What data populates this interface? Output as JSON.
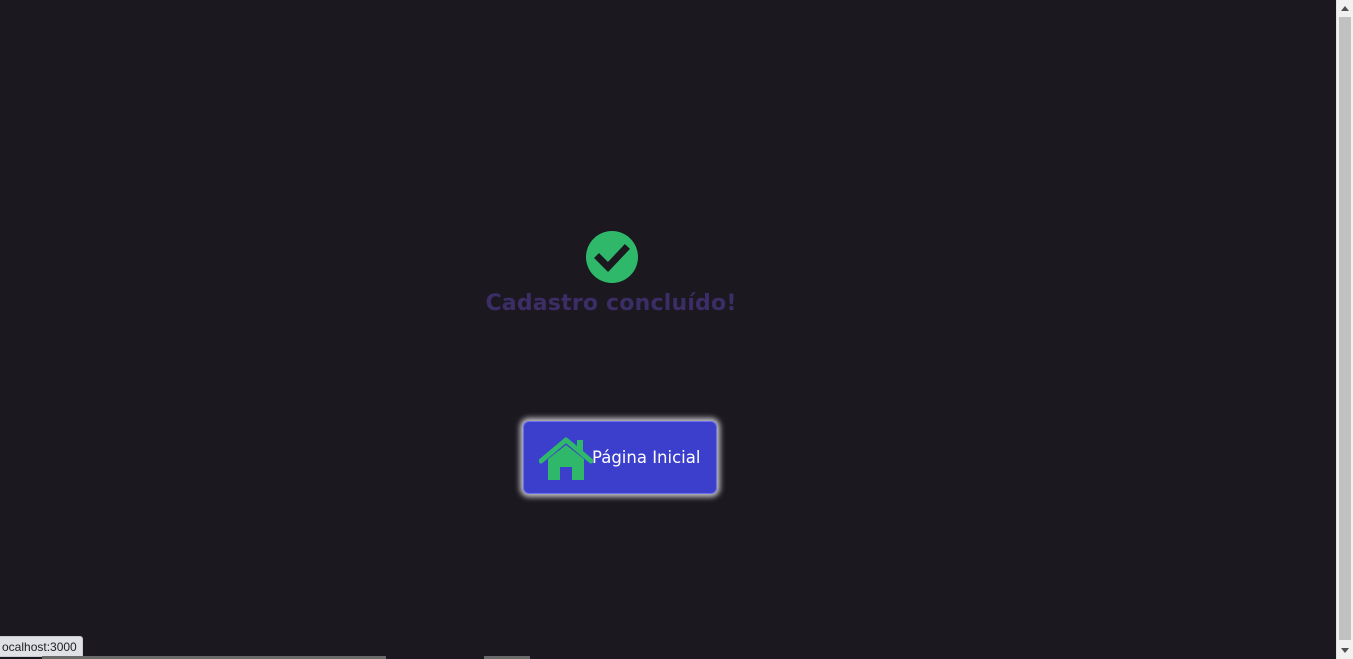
{
  "page": {
    "title": "Cadastro concluído!",
    "status_icon": "check-circle-icon",
    "status_color": "#2fb86a",
    "title_color": "#3b2e66",
    "background_color": "#1b1820"
  },
  "home_button": {
    "label": "Página Inicial",
    "icon": "home-icon",
    "icon_color": "#2fb86a",
    "background_color": "#3b3fcc"
  },
  "status_bar": {
    "url": "ocalhost:3000"
  },
  "scrollbar": {
    "up_icon": "scroll-up-arrow-icon",
    "down_icon": "scroll-down-arrow-icon"
  }
}
